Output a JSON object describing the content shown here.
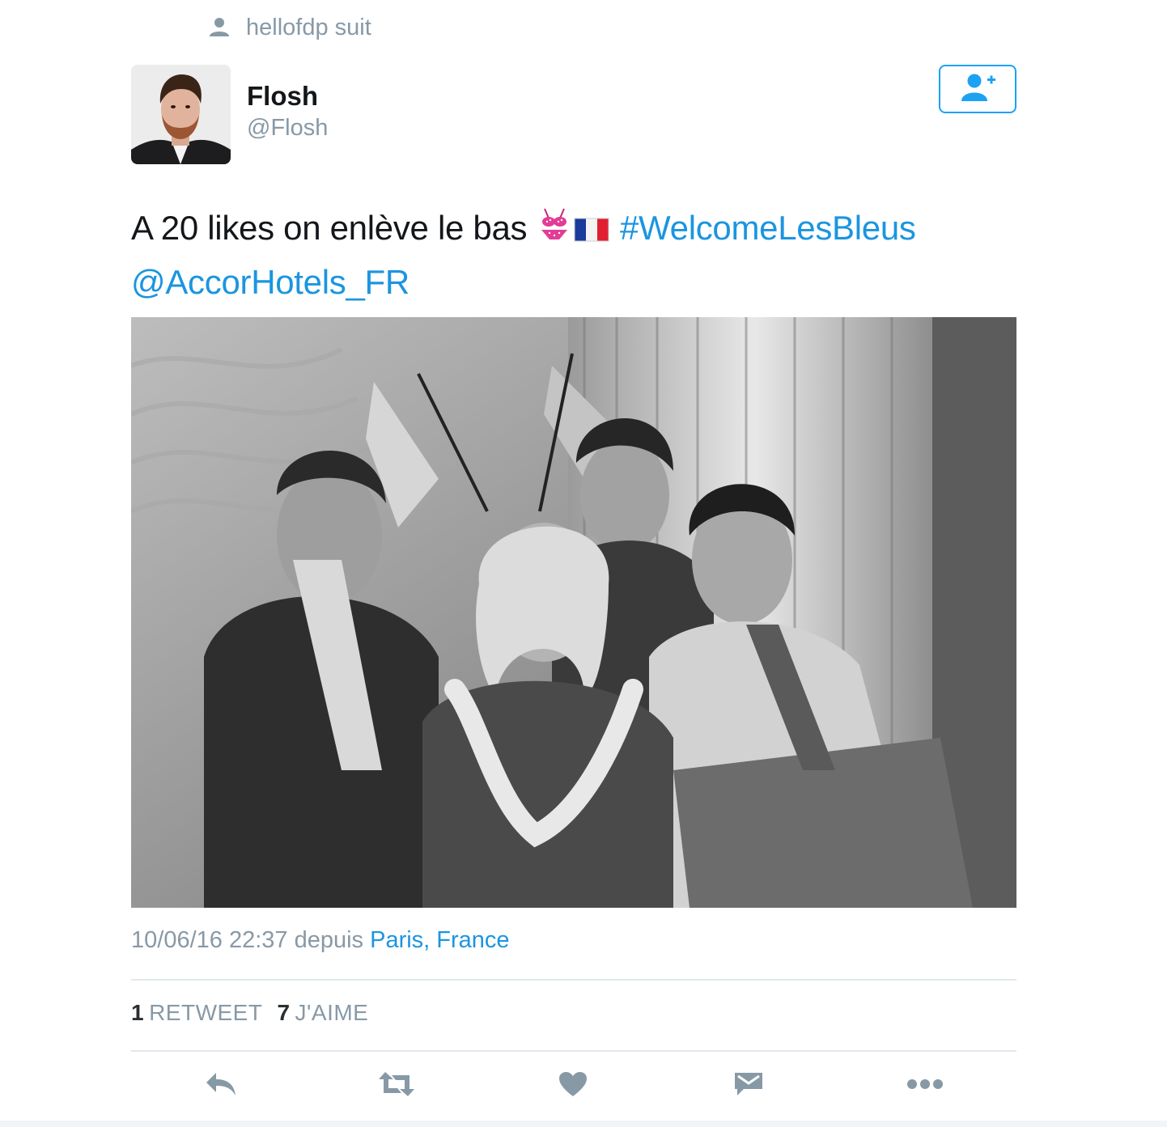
{
  "social_context": {
    "text": "hellofdp suit",
    "icon": "person-icon"
  },
  "author": {
    "name": "Flosh",
    "handle": "@Flosh"
  },
  "follow_button": {
    "icon": "add-user-icon"
  },
  "tweet": {
    "text_main": "A 20 likes on enlève le bas",
    "emojis": [
      "bikini",
      "france-flag"
    ],
    "hashtag": "#WelcomeLesBleus",
    "mention": "@AccorHotels_FR"
  },
  "meta": {
    "timestamp": "10/06/16 22:37",
    "via": "depuis",
    "location": "Paris, France"
  },
  "stats": {
    "retweet_count": "1",
    "retweet_label": "RETWEET",
    "like_count": "7",
    "like_label": "J'AIME"
  },
  "actions": [
    "reply-icon",
    "retweet-icon",
    "like-icon",
    "message-icon",
    "more-icon"
  ],
  "colors": {
    "link": "#1b95e0",
    "muted": "#8899a6",
    "text": "#14171a",
    "divider": "#e1e8ed"
  }
}
